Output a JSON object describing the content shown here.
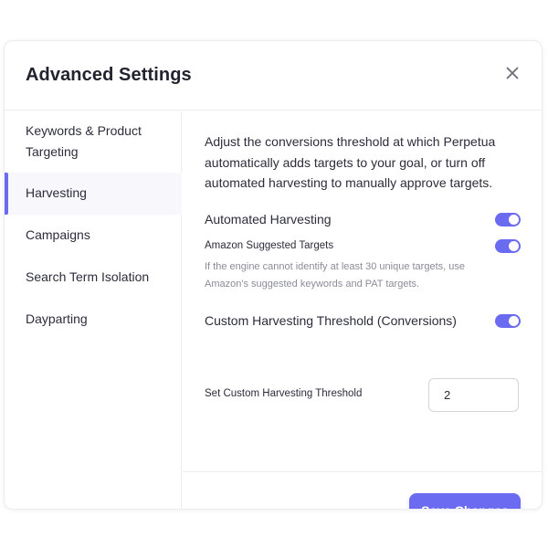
{
  "modal": {
    "title": "Advanced Settings",
    "close_icon": "close-icon"
  },
  "sidebar": {
    "items": [
      {
        "label": "Keywords & Product Targeting",
        "active": false
      },
      {
        "label": "Harvesting",
        "active": true
      },
      {
        "label": "Campaigns",
        "active": false
      },
      {
        "label": "Search Term Isolation",
        "active": false
      },
      {
        "label": "Dayparting",
        "active": false
      }
    ]
  },
  "content": {
    "description": "Adjust the conversions threshold at which Perpetua automatically adds targets to your goal, or turn off automated harvesting to manually approve targets.",
    "automated_harvesting": {
      "label": "Automated Harvesting",
      "enabled": true
    },
    "amazon_suggested": {
      "label": "Amazon Suggested Targets",
      "enabled": true,
      "helper": "If the engine cannot identify at least 30 unique targets, use Amazon's suggested keywords and PAT targets."
    },
    "custom_threshold": {
      "label": "Custom Harvesting Threshold (Conversions)",
      "enabled": true
    },
    "set_threshold": {
      "label": "Set Custom Harvesting Threshold",
      "value": "2"
    },
    "save_label": "Save Changes"
  },
  "colors": {
    "accent": "#6a6bf0",
    "text": "#2b2d3b",
    "muted": "#8a8c98",
    "border": "#ececf1"
  }
}
